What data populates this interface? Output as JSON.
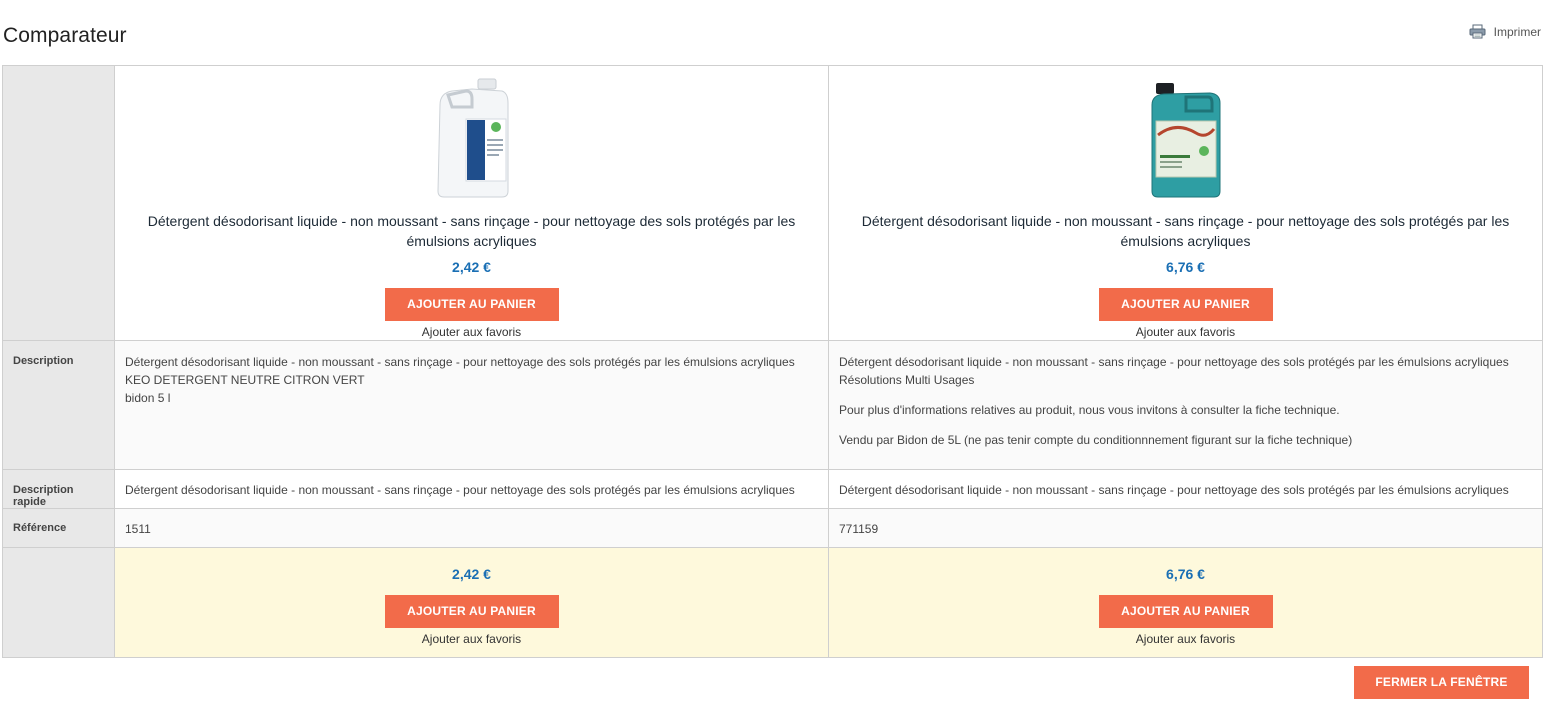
{
  "page": {
    "title": "Comparateur",
    "print_label": "Imprimer",
    "close_label": "FERMER LA FENÊTRE"
  },
  "labels": {
    "description": "Description",
    "quick_description": "Description rapide",
    "reference": "Référence"
  },
  "products": [
    {
      "name": "Détergent désodorisant liquide - non moussant - sans rinçage - pour nettoyage des sols protégés par les émulsions acryliques",
      "price": "2,42 €",
      "add_to_cart": "AJOUTER AU PANIER",
      "add_to_favorites": "Ajouter aux favoris",
      "image_icon": "white-jerrycan-product-image",
      "image_color": "#f2f4f6",
      "description": [
        [
          "Détergent désodorisant liquide - non moussant - sans rinçage - pour nettoyage des sols protégés par les émulsions acryliques",
          "KEO DETERGENT NEUTRE CITRON VERT",
          "bidon 5 l"
        ]
      ],
      "quick_description": "Détergent désodorisant liquide - non moussant - sans rinçage - pour nettoyage des sols protégés par les émulsions acryliques",
      "reference": "1511"
    },
    {
      "name": "Détergent désodorisant liquide - non moussant - sans rinçage - pour nettoyage des sols protégés par les émulsions acryliques",
      "price": "6,76 €",
      "add_to_cart": "AJOUTER AU PANIER",
      "add_to_favorites": "Ajouter aux favoris",
      "image_icon": "teal-jerrycan-product-image",
      "image_color": "#2e9ea3",
      "description": [
        [
          "Détergent désodorisant liquide - non moussant - sans rinçage - pour nettoyage des sols protégés par les émulsions acryliques",
          "Résolutions Multi Usages"
        ],
        [
          "Pour plus d'informations relatives au produit, nous vous invitons à consulter la fiche technique."
        ],
        [
          "Vendu par Bidon de 5L (ne pas tenir compte du conditionnnement figurant sur la fiche technique)"
        ]
      ],
      "quick_description": "Détergent désodorisant liquide - non moussant - sans rinçage - pour nettoyage des sols protégés par les émulsions acryliques",
      "reference": "771159"
    }
  ],
  "colors": {
    "accent": "#f26b4a",
    "price": "#1a6fb4",
    "footer_bg": "#fef9dc",
    "label_bg": "#e8e8e8"
  }
}
